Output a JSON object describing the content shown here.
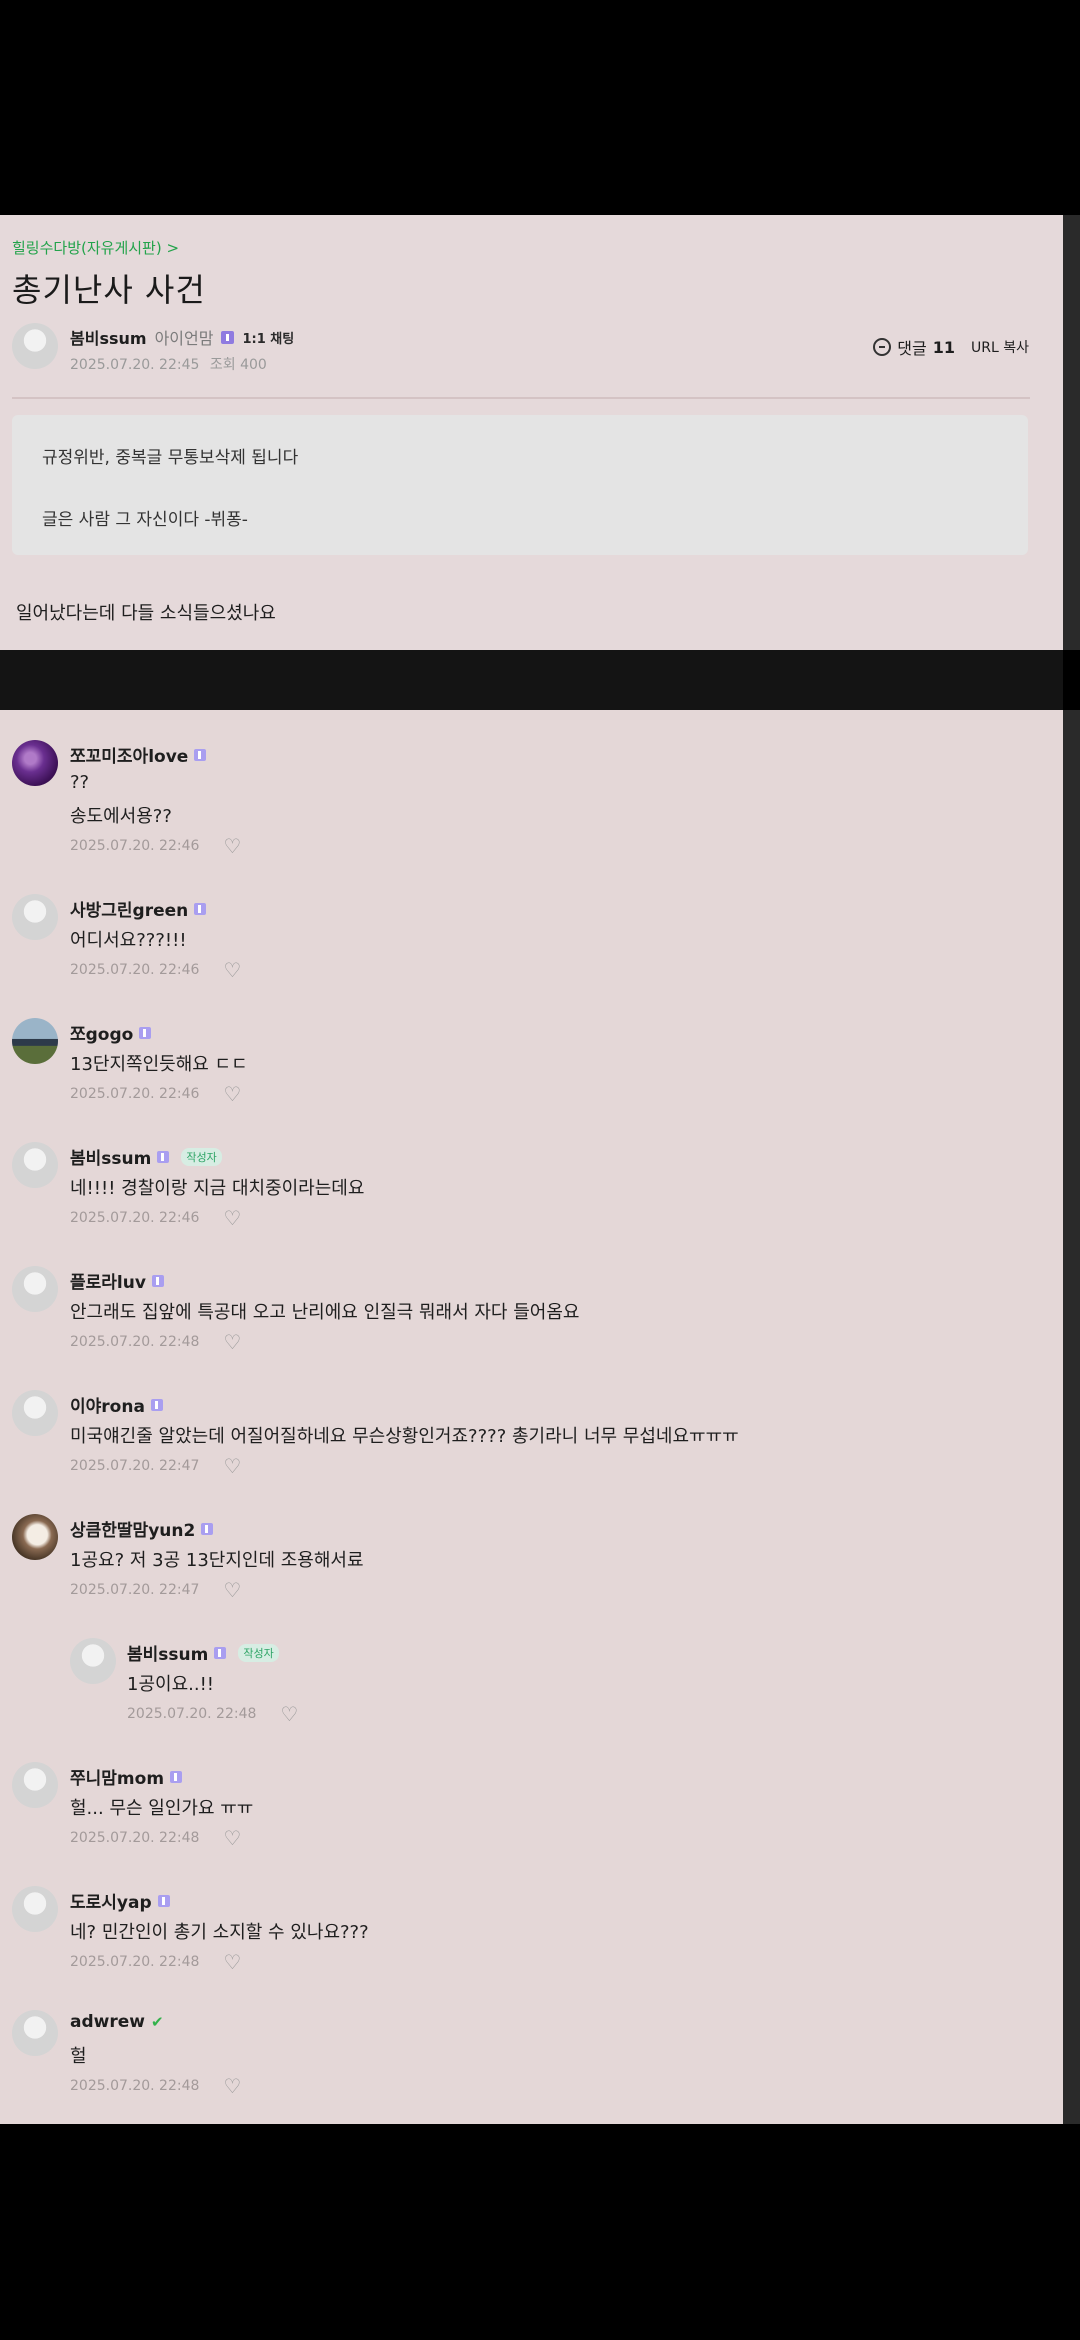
{
  "post": {
    "breadcrumb": "힐링수다방(자유게시판) >",
    "title": "총기난사 사건",
    "author": "봄비ssum",
    "author_level": "아이언맘",
    "chat_label": "1:1 채팅",
    "datetime": "2025.07.20. 22:45",
    "views": "조회 400",
    "comments_label": "댓글",
    "comments_count": "11",
    "url_copy": "URL 복사",
    "notice_line1": "규정위반, 중복글 무통보삭제 됩니다",
    "notice_line2": "글은 사람 그 자신이다 -뷔퐁-",
    "body": "일어났다는데 다들 소식들으셨나요"
  },
  "author_tag": "작성자",
  "comments": [
    {
      "name": "쪼꼬미조아love",
      "lines": [
        "??",
        "송도에서용??"
      ],
      "time": "2025.07.20. 22:46"
    },
    {
      "name": "사방그린green",
      "lines": [
        "어디서요???!!!"
      ],
      "time": "2025.07.20. 22:46"
    },
    {
      "name": "쪼gogo",
      "lines": [
        "13단지쪽인듯해요 ㄷㄷ"
      ],
      "time": "2025.07.20. 22:46"
    },
    {
      "name": "봄비ssum",
      "lines": [
        "네!!!! 경찰이랑 지금 대치중이라는데요"
      ],
      "time": "2025.07.20. 22:46"
    },
    {
      "name": "플로라luv",
      "lines": [
        "안그래도 집앞에 특공대 오고 난리에요 인질극 뭐래서 자다 들어옴요"
      ],
      "time": "2025.07.20. 22:48"
    },
    {
      "name": "이야rona",
      "lines": [
        "미국얘긴줄 알았는데 어질어질하네요 무슨상황인거죠???? 총기라니 너무 무섭네요ㅠㅠㅠ"
      ],
      "time": "2025.07.20. 22:47"
    },
    {
      "name": "상큼한딸맘yun2",
      "lines": [
        "1공요? 저 3공 13단지인데 조용해서료"
      ],
      "time": "2025.07.20. 22:47"
    },
    {
      "name": "봄비ssum",
      "lines": [
        "1공이요..!!"
      ],
      "time": "2025.07.20. 22:48"
    },
    {
      "name": "쭈니맘mom",
      "lines": [
        "헐... 무슨 일인가요 ㅠㅠ"
      ],
      "time": "2025.07.20. 22:48"
    },
    {
      "name": "도로시yap",
      "lines": [
        "네? 민간인이 총기 소지할 수 있나요???"
      ],
      "time": "2025.07.20. 22:48"
    },
    {
      "name": "adwrew",
      "lines": [
        "헐"
      ],
      "time": "2025.07.20. 22:48"
    }
  ]
}
